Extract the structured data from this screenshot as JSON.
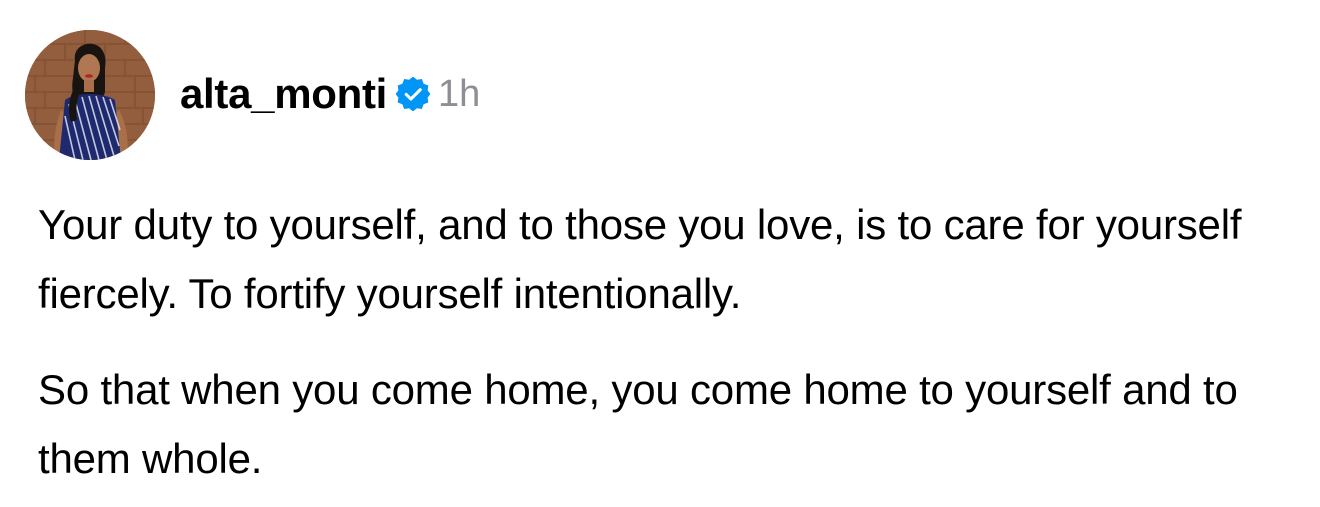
{
  "post": {
    "username": "alta_monti",
    "verified": true,
    "verified_icon": "verified-badge-icon",
    "time": "1h",
    "paragraphs": [
      "Your duty to yourself, and to those you love, is to care for yourself fiercely. To fortify yourself intentionally.",
      "So that when you come home, you come home to yourself and to them whole."
    ]
  },
  "colors": {
    "text": "#000000",
    "muted": "#8e8e93",
    "verified_blue": "#0095f6",
    "background": "#ffffff"
  }
}
